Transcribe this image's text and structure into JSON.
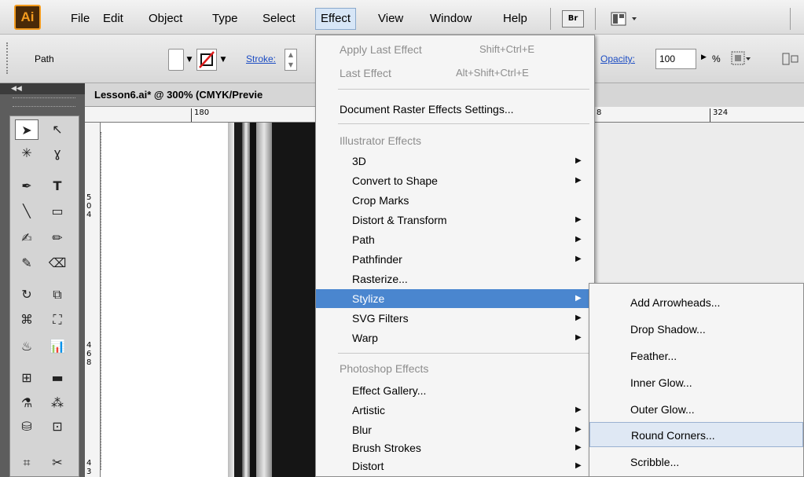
{
  "app": {
    "logo": "Ai"
  },
  "menubar": {
    "items": [
      "File",
      "Edit",
      "Object",
      "Type",
      "Select",
      "Effect",
      "View",
      "Window",
      "Help"
    ],
    "bridge_label": "Br"
  },
  "control_bar": {
    "selection_type": "Path",
    "stroke_label": "Stroke:",
    "opacity_label": "Opacity:",
    "opacity_value": "100",
    "opacity_unit": "%"
  },
  "document": {
    "tab_title": "Lesson6.ai* @ 300% (CMYK/Previe",
    "ruler_top": [
      "180"
    ],
    "ruler_top_right": [
      "8",
      "324"
    ],
    "ruler_left_a": [
      "5",
      "0",
      "4"
    ],
    "ruler_left_b": [
      "4",
      "6",
      "8"
    ],
    "ruler_left_c": [
      "4",
      "3"
    ]
  },
  "effect_menu": {
    "apply_last": {
      "label": "Apply Last Effect",
      "shortcut": "Shift+Ctrl+E"
    },
    "last_effect": {
      "label": "Last Effect",
      "shortcut": "Alt+Shift+Ctrl+E"
    },
    "doc_raster": "Document Raster Effects Settings...",
    "illustrator_header": "Illustrator Effects",
    "illustrator_items": [
      "3D",
      "Convert to Shape",
      "Crop Marks",
      "Distort & Transform",
      "Path",
      "Pathfinder",
      "Rasterize...",
      "Stylize",
      "SVG Filters",
      "Warp"
    ],
    "photoshop_header": "Photoshop Effects",
    "photoshop_items": [
      "Effect Gallery...",
      "Artistic",
      "Blur",
      "Brush Strokes",
      "Distort"
    ]
  },
  "stylize_submenu": {
    "items": [
      "Add Arrowheads...",
      "Drop Shadow...",
      "Feather...",
      "Inner Glow...",
      "Outer Glow...",
      "Round Corners...",
      "Scribble..."
    ]
  },
  "colors": {
    "highlight": "#4a86cf",
    "ai_orange": "#f39b1e"
  }
}
